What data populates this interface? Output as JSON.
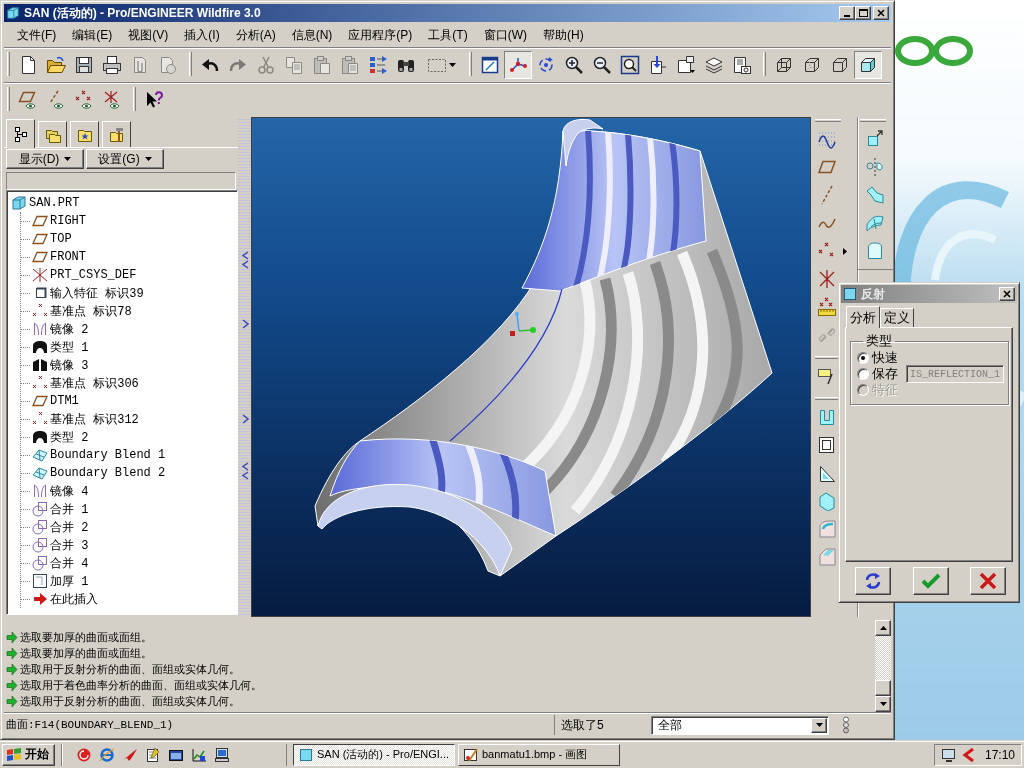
{
  "window": {
    "title": "SAN (活动的) - Pro/ENGINEER Wildfire 3.0"
  },
  "menu": [
    "文件(F)",
    "编辑(E)",
    "视图(V)",
    "插入(I)",
    "分析(A)",
    "信息(N)",
    "应用程序(P)",
    "工具(T)",
    "窗口(W)",
    "帮助(H)"
  ],
  "toolbar_rows": [
    [
      [
        {
          "kind": "new",
          "pressed": false,
          "disabled": false
        },
        {
          "kind": "open",
          "pressed": false,
          "disabled": false
        },
        {
          "kind": "save",
          "pressed": false,
          "disabled": false
        },
        {
          "kind": "print",
          "pressed": false,
          "disabled": false
        },
        {
          "kind": "attach",
          "pressed": false,
          "disabled": true
        },
        {
          "kind": "send",
          "pressed": false,
          "disabled": true
        }
      ],
      [
        {
          "kind": "undo",
          "pressed": false,
          "disabled": false
        },
        {
          "kind": "redo",
          "pressed": false,
          "disabled": true
        },
        {
          "kind": "cut",
          "pressed": false,
          "disabled": true
        },
        {
          "kind": "copy",
          "pressed": false,
          "disabled": true
        },
        {
          "kind": "paste",
          "pressed": false,
          "disabled": true
        },
        {
          "kind": "special",
          "pressed": false,
          "disabled": true
        },
        {
          "kind": "regenerate",
          "pressed": false,
          "disabled": false
        },
        {
          "kind": "find",
          "pressed": false,
          "disabled": false
        },
        {
          "kind": "select",
          "pressed": false,
          "disabled": false
        }
      ],
      [
        {
          "kind": "repaint",
          "pressed": false,
          "disabled": false
        },
        {
          "kind": "spin",
          "pressed": true,
          "disabled": false
        },
        {
          "kind": "orient",
          "pressed": false,
          "disabled": false
        },
        {
          "kind": "zoomin",
          "pressed": false,
          "disabled": false
        },
        {
          "kind": "zoomout",
          "pressed": false,
          "disabled": false
        },
        {
          "kind": "refit",
          "pressed": false,
          "disabled": false
        },
        {
          "kind": "reorient",
          "pressed": false,
          "disabled": false
        },
        {
          "kind": "views",
          "pressed": false,
          "disabled": false
        },
        {
          "kind": "layers",
          "pressed": false,
          "disabled": false
        },
        {
          "kind": "manager",
          "pressed": false,
          "disabled": false
        }
      ],
      [
        {
          "kind": "wireframe",
          "pressed": false,
          "disabled": false
        },
        {
          "kind": "hidden",
          "pressed": false,
          "disabled": false
        },
        {
          "kind": "nohidden",
          "pressed": false,
          "disabled": false
        },
        {
          "kind": "shaded",
          "pressed": true,
          "disabled": false
        }
      ]
    ],
    [
      [
        {
          "kind": "planes",
          "pressed": false,
          "disabled": false
        },
        {
          "kind": "axes",
          "pressed": false,
          "disabled": false
        },
        {
          "kind": "points",
          "pressed": false,
          "disabled": false
        },
        {
          "kind": "csys",
          "pressed": false,
          "disabled": false
        }
      ],
      [
        {
          "kind": "help",
          "pressed": false,
          "disabled": false
        }
      ]
    ]
  ],
  "model_tree": {
    "tabs": [
      {
        "kind": "tree",
        "selected": true
      },
      {
        "kind": "folders",
        "selected": false
      },
      {
        "kind": "favorites",
        "selected": false
      },
      {
        "kind": "tools",
        "selected": false
      }
    ],
    "menus": [
      "显示(D)",
      "设置(G)"
    ],
    "root": {
      "label": "SAN.PRT",
      "kind": "part",
      "children": [
        {
          "label": "RIGHT",
          "kind": "plane"
        },
        {
          "label": "TOP",
          "kind": "plane"
        },
        {
          "label": "FRONT",
          "kind": "plane"
        },
        {
          "label": "PRT_CSYS_DEF",
          "kind": "csys"
        },
        {
          "label": "输入特征 标识39",
          "kind": "import"
        },
        {
          "label": "基准点 标识78",
          "kind": "point"
        },
        {
          "label": "镜像 2",
          "kind": "mirror"
        },
        {
          "label": "类型 1",
          "kind": "solid"
        },
        {
          "label": "镜像 3",
          "kind": "split"
        },
        {
          "label": "基准点 标识306",
          "kind": "point"
        },
        {
          "label": "DTM1",
          "kind": "plane"
        },
        {
          "label": "基准点 标识312",
          "kind": "point"
        },
        {
          "label": "类型 2",
          "kind": "solid"
        },
        {
          "label": "Boundary Blend 1",
          "kind": "blend"
        },
        {
          "label": "Boundary Blend 2",
          "kind": "blend"
        },
        {
          "label": "镜像 4",
          "kind": "mirror"
        },
        {
          "label": "合并 1",
          "kind": "merge"
        },
        {
          "label": "合并 2",
          "kind": "merge"
        },
        {
          "label": "合并 3",
          "kind": "merge"
        },
        {
          "label": "合并 4",
          "kind": "merge"
        },
        {
          "label": "加厚 1",
          "kind": "thicken"
        },
        {
          "label": "在此插入",
          "kind": "insert"
        }
      ]
    }
  },
  "right_toolbar": [
    [
      [
        {
          "kind": "sketch",
          "disabled": false
        },
        {
          "kind": "plane",
          "disabled": false
        },
        {
          "kind": "axis",
          "disabled": false
        },
        {
          "kind": "curve",
          "disabled": false
        },
        {
          "kind": "pointmenu",
          "disabled": false
        },
        {
          "kind": "csys",
          "disabled": false
        },
        {
          "kind": "offset",
          "disabled": false
        },
        {
          "kind": "link",
          "disabled": true
        }
      ],
      [
        {
          "kind": "note",
          "disabled": false
        }
      ],
      [
        {
          "kind": "channel",
          "disabled": false
        },
        {
          "kind": "hole",
          "disabled": false
        },
        {
          "kind": "rib",
          "disabled": false
        },
        {
          "kind": "shell",
          "disabled": false
        },
        {
          "kind": "round",
          "disabled": false
        },
        {
          "kind": "chamfer",
          "disabled": false
        }
      ]
    ],
    [
      [
        {
          "kind": "transform",
          "disabled": false
        },
        {
          "kind": "mirror",
          "disabled": false
        },
        {
          "kind": "sweep",
          "disabled": false
        },
        {
          "kind": "patch",
          "disabled": false
        },
        {
          "kind": "boundary",
          "disabled": false
        }
      ]
    ]
  ],
  "messages": [
    "选取要加厚的曲面或面组。",
    "选取要加厚的曲面或面组。",
    "选取用于反射分析的曲面、面组或实体几何。",
    "选取用于着色曲率分析的曲面、面组或实体几何。",
    "选取用于反射分析的曲面、面组或实体几何。"
  ],
  "status_bar": {
    "message": "曲面:F14(BOUNDARY_BLEND_1)",
    "selection": "选取了5",
    "filter": "全部"
  },
  "dialog": {
    "title": "反射",
    "tabs": [
      {
        "label": "分析",
        "selected": true
      },
      {
        "label": "定义",
        "selected": false
      }
    ],
    "group": "类型",
    "options": [
      {
        "label": "快速",
        "selected": true,
        "disabled": false
      },
      {
        "label": "保存",
        "selected": false,
        "disabled": false,
        "field": {
          "value": "IS_REFLECTION_1",
          "disabled": true
        }
      },
      {
        "label": "特征",
        "selected": false,
        "disabled": true
      }
    ],
    "buttons": [
      {
        "kind": "repeat"
      },
      {
        "kind": "ok"
      },
      {
        "kind": "cancel"
      }
    ]
  },
  "taskbar": {
    "start": "开始",
    "quick_launch": [
      {
        "kind": "spiral"
      },
      {
        "kind": "browser"
      },
      {
        "kind": "wing"
      },
      {
        "kind": "notepad"
      },
      {
        "kind": "window"
      },
      {
        "kind": "chart"
      },
      {
        "kind": "computer"
      }
    ],
    "tasks": [
      {
        "label": "SAN (活动的) - Pro/ENGI...",
        "kind": "proe",
        "selected": true
      },
      {
        "label": "banmatu1.bmp - 画图",
        "kind": "paint",
        "selected": false
      }
    ],
    "tray": [
      {
        "kind": "monitor"
      },
      {
        "kind": "chevron"
      }
    ],
    "clock": "17:10"
  }
}
